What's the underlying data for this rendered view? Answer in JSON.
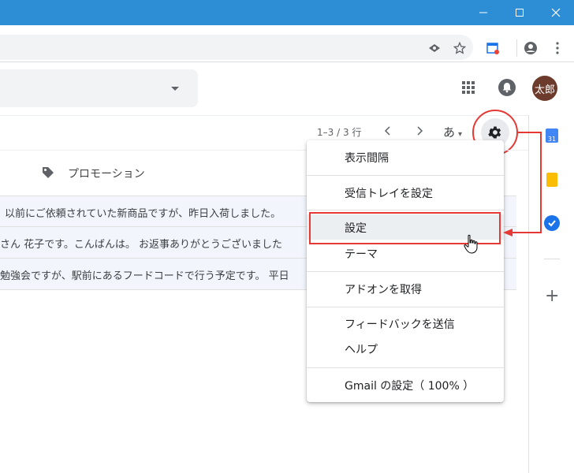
{
  "window": {
    "minimize_icon": "minimize-icon",
    "maximize_icon": "maximize-icon",
    "close_icon": "close-icon"
  },
  "browser_toolbar": {
    "icons": [
      "eye-icon",
      "star-icon",
      "calendar-ext-icon",
      "account-icon",
      "more-vert-icon"
    ]
  },
  "header": {
    "avatar_text": "太郎"
  },
  "list_toolbar": {
    "pager_text": "1–3 / 3 行",
    "ime_label": "あ",
    "ime_caret": "▾"
  },
  "tabs": {
    "promotions_label": "プロモーション"
  },
  "emails": [
    {
      "snippet": "以前にご依頼されていた新商品ですが、昨日入荷しました。"
    },
    {
      "snippet": "さん 花子です。こんばんは。 お返事ありがとうございました"
    },
    {
      "snippet": "勉強会ですが、駅前にあるフードコードで行う予定です。 平日"
    }
  ],
  "side_panel": {
    "calendar_day": "31",
    "add_label": "+"
  },
  "menu": {
    "items": [
      "表示間隔",
      "受信トレイを設定",
      "設定",
      "テーマ",
      "アドオンを取得",
      "フィードバックを送信",
      "ヘルプ",
      "Gmail の設定（ 100% ）"
    ]
  },
  "colors": {
    "titlebar": "#2d8ed6",
    "highlight_red": "#e53935",
    "row_bg": "#f2f6fc"
  }
}
